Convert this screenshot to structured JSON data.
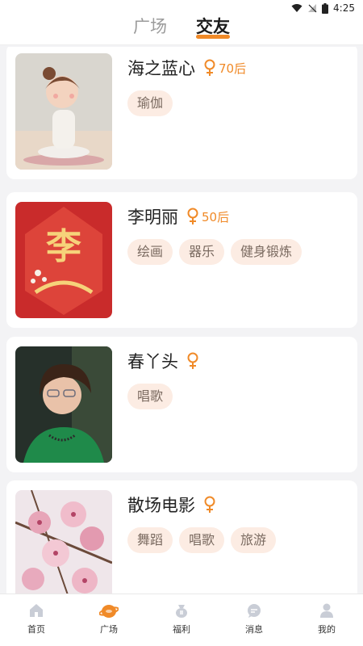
{
  "status_bar": {
    "time": "4:25"
  },
  "header": {
    "tabs": [
      {
        "label": "广场",
        "active": false
      },
      {
        "label": "交友",
        "active": true
      }
    ]
  },
  "accent_color": "#f08a28",
  "tag_bg_color": "#fcece3",
  "profiles": [
    {
      "name": "海之蓝心",
      "gender_icon": "female-icon",
      "age": "70后",
      "tags": [
        "瑜伽"
      ]
    },
    {
      "name": "李明丽",
      "gender_icon": "female-icon",
      "age": "50后",
      "tags": [
        "绘画",
        "器乐",
        "健身锻炼"
      ]
    },
    {
      "name": "春丫头",
      "gender_icon": "female-icon",
      "age": "",
      "tags": [
        "唱歌"
      ]
    },
    {
      "name": "散场电影",
      "gender_icon": "female-icon",
      "age": "",
      "tags": [
        "舞蹈",
        "唱歌",
        "旅游"
      ]
    }
  ],
  "bottom_nav": [
    {
      "label": "首页",
      "icon": "home-icon",
      "active": false
    },
    {
      "label": "广场",
      "icon": "plaza-icon",
      "active": true
    },
    {
      "label": "福利",
      "icon": "gift-bag-icon",
      "active": false
    },
    {
      "label": "消息",
      "icon": "chat-bubble-icon",
      "active": false
    },
    {
      "label": "我的",
      "icon": "person-icon",
      "active": false
    }
  ]
}
